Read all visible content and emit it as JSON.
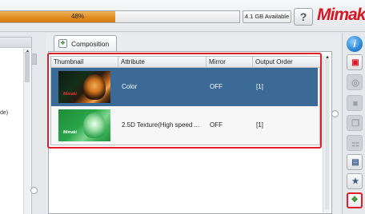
{
  "header": {
    "progress_text": "48%",
    "progress_fraction": 0.48,
    "storage_text": "4.1 GB Available",
    "help_label": "?",
    "brand": "Mimak"
  },
  "left_panel": {
    "partial_text": "de)"
  },
  "tab": {
    "label": "Composition",
    "icon": "composition-icon"
  },
  "table": {
    "columns": [
      "Thumbnail",
      "Attribute",
      "Mirror",
      "Output Order"
    ],
    "rows": [
      {
        "thumbnail": "tiger-color-thumbnail",
        "thumbnail_logo": "Mimaki",
        "attribute": "Color",
        "mirror": "OFF",
        "output_order": "[1]",
        "selected": true
      },
      {
        "thumbnail": "tiger-texture-thumbnail",
        "thumbnail_logo": "Mimaki",
        "attribute": "2.5D Texture(High speed ...",
        "mirror": "OFF",
        "output_order": "[1]",
        "selected": false
      }
    ]
  },
  "toolbar": {
    "items": [
      {
        "icon": "info-icon",
        "glyph": "i",
        "state": "normal"
      },
      {
        "icon": "layout-red-icon",
        "glyph": "▣",
        "state": "normal"
      },
      {
        "icon": "disabled-target-icon",
        "glyph": "◎",
        "state": "disabled"
      },
      {
        "icon": "disabled-block-icon",
        "glyph": "■",
        "state": "disabled"
      },
      {
        "icon": "copy-layers-icon",
        "glyph": "❐",
        "state": "disabled"
      },
      {
        "icon": "grid-layout-icon",
        "glyph": "⚏",
        "state": "disabled"
      },
      {
        "icon": "printer-icon",
        "glyph": "▤",
        "state": "normal"
      },
      {
        "icon": "star-layer-icon",
        "glyph": "★",
        "state": "normal"
      },
      {
        "icon": "composition-icon",
        "glyph": "❖",
        "state": "active"
      }
    ]
  },
  "colors": {
    "accent_red": "#e21d2a",
    "selection_blue": "#3c6a96",
    "progress_orange": "#e28d22"
  }
}
